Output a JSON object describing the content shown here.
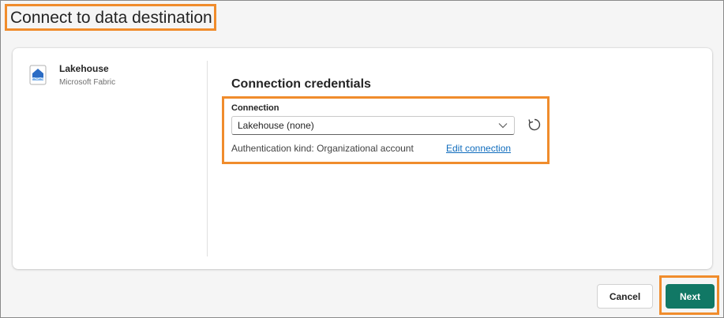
{
  "page": {
    "title": "Connect to data destination"
  },
  "destination": {
    "name": "Lakehouse",
    "provider": "Microsoft Fabric",
    "icon": "lakehouse-icon"
  },
  "credentials": {
    "heading": "Connection credentials",
    "connection_label": "Connection",
    "connection_value": "Lakehouse (none)",
    "auth_text": "Authentication kind: Organizational account",
    "edit_link": "Edit connection"
  },
  "footer": {
    "cancel_label": "Cancel",
    "next_label": "Next"
  },
  "colors": {
    "primary": "#117865",
    "link": "#0f6cbd",
    "highlight": "#f08c2c"
  }
}
